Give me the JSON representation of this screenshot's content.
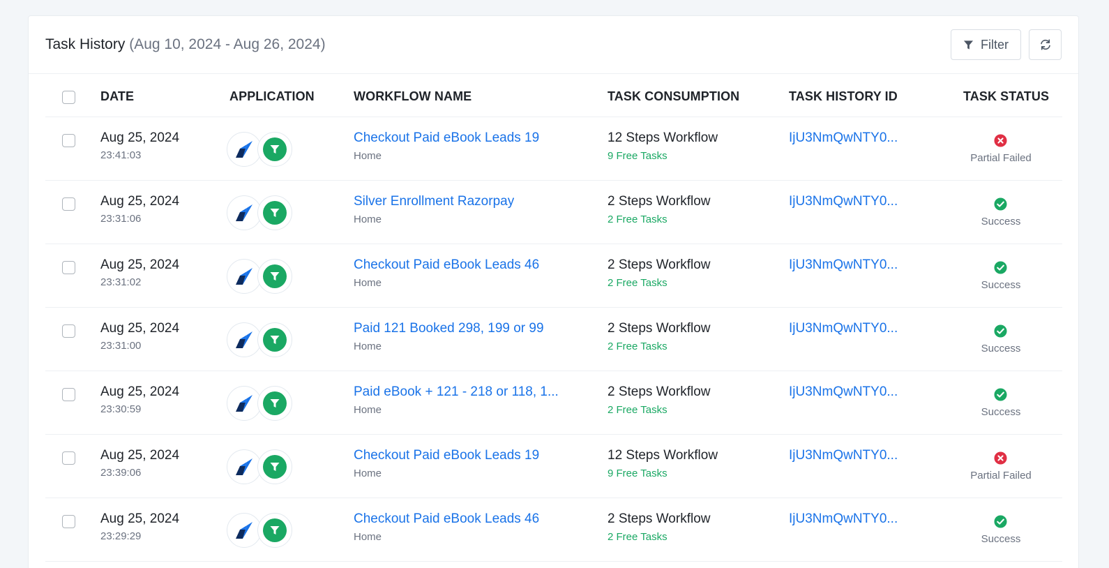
{
  "header": {
    "title": "Task History",
    "date_range": "(Aug 10, 2024 - Aug 26, 2024)",
    "filter_label": "Filter"
  },
  "columns": {
    "date": "DATE",
    "application": "APPLICATION",
    "workflow_name": "WORKFLOW NAME",
    "task_consumption": "TASK CONSUMPTION",
    "task_history_id": "TASK HISTORY ID",
    "task_status": "TASK STATUS"
  },
  "colors": {
    "link": "#1a73e8",
    "success": "#1aa863",
    "failed": "#e02f44",
    "app_icon_primary": "#1a73e8",
    "app_icon_dark": "#0d2b5e"
  },
  "icons": {
    "filter": "filter-icon",
    "refresh": "refresh-icon",
    "app_1": "rocket-app-icon",
    "app_2": "filter-app-icon",
    "status_success": "check-circle-icon",
    "status_failed": "x-circle-icon"
  },
  "rows": [
    {
      "date": "Aug 25, 2024",
      "time": "23:41:03",
      "workflow": "Checkout Paid eBook Leads 19",
      "workflow_sub": "Home",
      "consumption": "12 Steps Workflow",
      "free_tasks": "9 Free Tasks",
      "history_id": "IjU3NmQwNTY0...",
      "status": "Partial Failed",
      "status_type": "failed"
    },
    {
      "date": "Aug 25, 2024",
      "time": "23:31:06",
      "workflow": "Silver Enrollment Razorpay",
      "workflow_sub": "Home",
      "consumption": "2 Steps Workflow",
      "free_tasks": "2 Free Tasks",
      "history_id": "IjU3NmQwNTY0...",
      "status": "Success",
      "status_type": "success"
    },
    {
      "date": "Aug 25, 2024",
      "time": "23:31:02",
      "workflow": "Checkout Paid eBook Leads 46",
      "workflow_sub": "Home",
      "consumption": "2 Steps Workflow",
      "free_tasks": "2 Free Tasks",
      "history_id": "IjU3NmQwNTY0...",
      "status": "Success",
      "status_type": "success"
    },
    {
      "date": "Aug 25, 2024",
      "time": "23:31:00",
      "workflow": "Paid 121 Booked 298, 199 or 99",
      "workflow_sub": "Home",
      "consumption": "2 Steps Workflow",
      "free_tasks": "2 Free Tasks",
      "history_id": "IjU3NmQwNTY0...",
      "status": "Success",
      "status_type": "success"
    },
    {
      "date": "Aug 25, 2024",
      "time": "23:30:59",
      "workflow": "Paid eBook + 121 - 218 or 118, 1...",
      "workflow_sub": "Home",
      "consumption": "2 Steps Workflow",
      "free_tasks": "2 Free Tasks",
      "history_id": "IjU3NmQwNTY0...",
      "status": "Success",
      "status_type": "success"
    },
    {
      "date": "Aug 25, 2024",
      "time": "23:39:06",
      "workflow": "Checkout Paid eBook Leads 19",
      "workflow_sub": "Home",
      "consumption": "12 Steps Workflow",
      "free_tasks": "9 Free Tasks",
      "history_id": "IjU3NmQwNTY0...",
      "status": "Partial Failed",
      "status_type": "failed"
    },
    {
      "date": "Aug 25, 2024",
      "time": "23:29:29",
      "workflow": "Checkout Paid eBook Leads 46",
      "workflow_sub": "Home",
      "consumption": "2 Steps Workflow",
      "free_tasks": "2 Free Tasks",
      "history_id": "IjU3NmQwNTY0...",
      "status": "Success",
      "status_type": "success"
    }
  ]
}
